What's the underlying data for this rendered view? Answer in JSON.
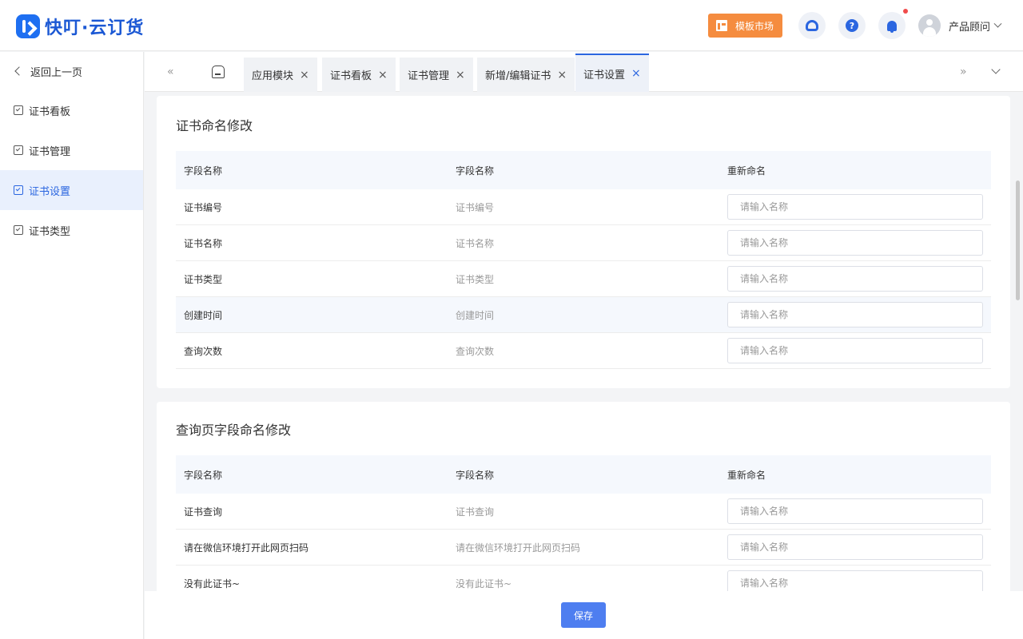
{
  "header": {
    "logo_text": "快叮·云订货",
    "template_market": "模板市场",
    "help_glyph": "?",
    "user_name": "产品顾问"
  },
  "sidebar": {
    "back_label": "返回上一页",
    "items": [
      {
        "label": "证书看板"
      },
      {
        "label": "证书管理"
      },
      {
        "label": "证书设置",
        "active": true
      },
      {
        "label": "证书类型"
      }
    ]
  },
  "tabs": {
    "prev_glyph": "«",
    "next_glyph": "»",
    "close_glyph": "×",
    "items": [
      {
        "label": "应用模块"
      },
      {
        "label": "证书看板"
      },
      {
        "label": "证书管理"
      },
      {
        "label": "新增/编辑证书"
      },
      {
        "label": "证书设置",
        "active": true
      }
    ]
  },
  "sections": [
    {
      "title": "证书命名修改",
      "columns": [
        "字段名称",
        "字段名称",
        "重新命名"
      ],
      "rows": [
        {
          "field": "证书编号",
          "name": "证书编号",
          "placeholder": "请输入名称"
        },
        {
          "field": "证书名称",
          "name": "证书名称",
          "placeholder": "请输入名称"
        },
        {
          "field": "证书类型",
          "name": "证书类型",
          "placeholder": "请输入名称"
        },
        {
          "field": "创建时间",
          "name": "创建时间",
          "placeholder": "请输入名称"
        },
        {
          "field": "查询次数",
          "name": "查询次数",
          "placeholder": "请输入名称"
        }
      ]
    },
    {
      "title": "查询页字段命名修改",
      "columns": [
        "字段名称",
        "字段名称",
        "重新命名"
      ],
      "rows": [
        {
          "field": "证书查询",
          "name": "证书查询",
          "placeholder": "请输入名称"
        },
        {
          "field": "请在微信环境打开此网页扫码",
          "name": "请在微信环境打开此网页扫码",
          "placeholder": "请输入名称"
        },
        {
          "field": "没有此证书~",
          "name": "没有此证书~",
          "placeholder": "请输入名称"
        }
      ]
    }
  ],
  "footer": {
    "save_label": "保存"
  },
  "colors": {
    "primary": "#2b66e0",
    "logo": "#1e6ff1",
    "template_button": "#f58c3f",
    "notification_dot": "#f04b4b",
    "save_button": "#4e7ef0"
  }
}
